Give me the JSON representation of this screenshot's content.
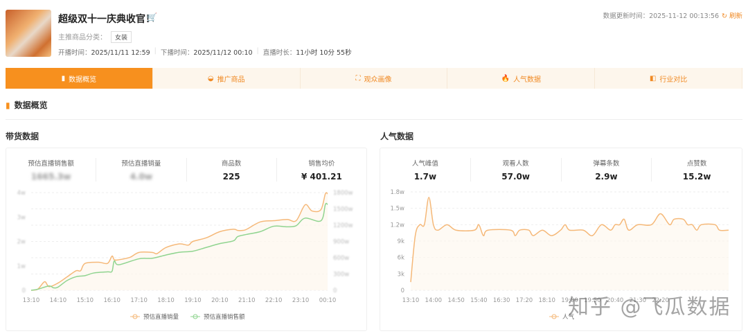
{
  "header": {
    "title": "超级双十一庆典收官！",
    "category_label": "主推商品分类：",
    "category": "女装",
    "start_label": "开播时间：",
    "start": "2025/11/11 12:59",
    "end_label": "下播时间：",
    "end": "2025/11/12 00:10",
    "duration_label": "直播时长：",
    "duration": "11小时 10分 55秒",
    "update_label": "数据更新时间：",
    "update_time": "2025-11-12 00:13:56",
    "refresh": "刷新"
  },
  "tabs": [
    {
      "label": "数据概览",
      "icon": "bar-chart-icon",
      "active": true
    },
    {
      "label": "推广商品",
      "icon": "bag-icon"
    },
    {
      "label": "观众画像",
      "icon": "portrait-icon"
    },
    {
      "label": "人气数据",
      "icon": "fire-icon"
    },
    {
      "label": "行业对比",
      "icon": "compare-icon"
    }
  ],
  "section_title": "数据概览",
  "sales": {
    "title": "带货数据",
    "stats": [
      {
        "k": "预估直播销售额",
        "v": "1665.3w"
      },
      {
        "k": "预估直播销量",
        "v": "4.0w"
      },
      {
        "k": "商品数",
        "v": "225"
      },
      {
        "k": "销售均价",
        "v": "¥ 401.21"
      }
    ]
  },
  "popularity": {
    "title": "人气数据",
    "stats": [
      {
        "k": "人气峰值",
        "v": "1.7w"
      },
      {
        "k": "观看人数",
        "v": "57.0w"
      },
      {
        "k": "弹幕条数",
        "v": "2.9w"
      },
      {
        "k": "点赞数",
        "v": "15.2w"
      }
    ]
  },
  "watermark": "知乎 @飞瓜数据",
  "colors": {
    "accent": "#f7901e",
    "orange_line": "#f5c088",
    "green_line": "#8fd48f"
  },
  "chart_data": [
    {
      "type": "line",
      "xlabels": [
        "13:10",
        "14:10",
        "15:10",
        "16:10",
        "17:10",
        "18:10",
        "19:10",
        "20:10",
        "21:10",
        "22:10",
        "23:10",
        "00:10"
      ],
      "ylim_left": [
        0,
        4
      ],
      "ytick_left": [
        "0",
        "1w",
        "2w",
        "3w",
        "4w"
      ],
      "ylim_right": [
        0,
        1800
      ],
      "ytick_right": [
        "0",
        "300w",
        "600w",
        "900w",
        "1200w",
        "1500w",
        "1800w"
      ],
      "grid": true,
      "legend": "bottom",
      "series": [
        {
          "name": "预估直播销量",
          "axis": "left",
          "color": "#f5b878",
          "x": [
            "13:10",
            "13:25",
            "13:40",
            "13:50",
            "14:10",
            "14:30",
            "14:50",
            "15:00",
            "15:10",
            "15:40",
            "16:00",
            "16:10",
            "16:15",
            "16:25",
            "16:50",
            "17:10",
            "17:40",
            "17:50",
            "18:10",
            "18:40",
            "19:00",
            "19:10",
            "19:40",
            "20:10",
            "20:40",
            "20:50",
            "21:00",
            "21:10",
            "21:40",
            "22:10",
            "22:40",
            "23:00",
            "23:20",
            "23:35",
            "23:55",
            "00:05",
            "00:10"
          ],
          "y": [
            0,
            0.05,
            0.35,
            0.15,
            0.3,
            0.55,
            0.8,
            0.8,
            1.1,
            1.15,
            1.1,
            1.4,
            1.25,
            1.25,
            1.35,
            1.55,
            1.55,
            1.5,
            1.75,
            1.9,
            1.85,
            2.0,
            2.15,
            2.4,
            2.5,
            2.45,
            2.45,
            2.5,
            2.8,
            2.85,
            2.9,
            2.85,
            3.5,
            3.25,
            3.3,
            3.95,
            3.95
          ]
        },
        {
          "name": "预估直播销售额",
          "axis": "right",
          "color": "#8fd48f",
          "x": [
            "13:10",
            "13:25",
            "13:50",
            "14:00",
            "14:10",
            "14:30",
            "14:50",
            "15:10",
            "15:30",
            "16:00",
            "16:10",
            "16:15",
            "16:25",
            "17:10",
            "17:40",
            "18:10",
            "18:40",
            "19:10",
            "19:40",
            "20:10",
            "20:40",
            "20:50",
            "21:10",
            "21:40",
            "22:10",
            "22:40",
            "23:00",
            "23:20",
            "23:55",
            "00:05",
            "00:10"
          ],
          "y": [
            0,
            20,
            80,
            45,
            60,
            180,
            250,
            270,
            320,
            340,
            350,
            540,
            470,
            580,
            590,
            650,
            700,
            720,
            790,
            860,
            910,
            990,
            1030,
            1080,
            1180,
            1170,
            1190,
            1330,
            1280,
            1580,
            1580
          ]
        }
      ]
    },
    {
      "type": "line",
      "xlabels": [
        "13:10",
        "14:00",
        "14:50",
        "15:40",
        "16:30",
        "17:20",
        "18:10",
        "19:00",
        "19:50",
        "20:40",
        "21:30",
        "22:20"
      ],
      "ylim": [
        0,
        18000
      ],
      "yticks": [
        "0",
        "3k",
        "6k",
        "9k",
        "1.2w",
        "1.5w",
        "1.8w"
      ],
      "grid": true,
      "legend": "bottom",
      "series": [
        {
          "name": "人气",
          "color": "#f5b878",
          "x": [
            "13:10",
            "13:20",
            "13:30",
            "13:40",
            "13:50",
            "14:00",
            "14:10",
            "14:30",
            "14:50",
            "15:30",
            "15:40",
            "15:50",
            "16:00",
            "16:50",
            "17:00",
            "17:10",
            "17:30",
            "17:40",
            "18:00",
            "18:20",
            "18:40",
            "18:50",
            "19:00",
            "19:30",
            "19:50",
            "20:10",
            "20:30",
            "20:40",
            "20:50",
            "21:00",
            "21:10",
            "21:30",
            "22:00",
            "22:20",
            "22:40",
            "22:50",
            "23:10",
            "23:20",
            "23:30",
            "23:40",
            "23:50",
            "00:20",
            "00:30",
            "00:50"
          ],
          "y": [
            1500,
            10000,
            12000,
            12000,
            17000,
            12000,
            11000,
            12000,
            11000,
            11000,
            12000,
            10000,
            11000,
            11000,
            10000,
            11000,
            11000,
            10000,
            11000,
            10000,
            11000,
            12000,
            11000,
            11000,
            10000,
            12000,
            11000,
            12000,
            12000,
            13000,
            11000,
            12000,
            12000,
            14000,
            12000,
            13000,
            13000,
            12000,
            12000,
            11000,
            12000,
            12000,
            11000,
            11000
          ]
        }
      ]
    }
  ]
}
